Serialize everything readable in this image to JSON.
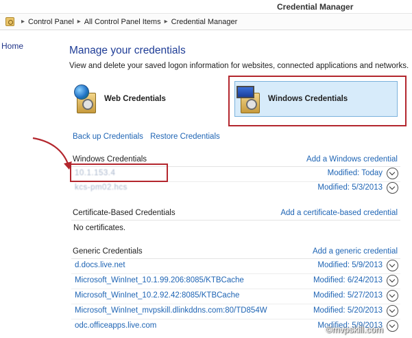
{
  "window": {
    "title": "Credential Manager"
  },
  "breadcrumb": [
    "Control Panel",
    "All Control Panel Items",
    "Credential Manager"
  ],
  "nav": {
    "home": "Home"
  },
  "main": {
    "heading": "Manage your credentials",
    "description": "View and delete your saved logon information for websites, connected applications and networks.",
    "tiles": {
      "web": "Web Credentials",
      "windows": "Windows Credentials"
    },
    "backup_link": "Back up Credentials",
    "restore_link": "Restore Credentials"
  },
  "windows_credentials": {
    "title": "Windows Credentials",
    "add_link": "Add a Windows credential",
    "items": [
      {
        "name": "10.1.153.4",
        "modified": "Modified:  Today"
      },
      {
        "name": "kcs-pm02.hcs",
        "modified": "Modified:  5/3/2013"
      }
    ]
  },
  "cert_credentials": {
    "title": "Certificate-Based Credentials",
    "add_link": "Add a certificate-based credential",
    "empty": "No certificates."
  },
  "generic_credentials": {
    "title": "Generic Credentials",
    "add_link": "Add a generic credential",
    "items": [
      {
        "name": "d.docs.live.net",
        "modified": "Modified:  5/9/2013"
      },
      {
        "name": "Microsoft_WinInet_10.1.99.206:8085/KTBCache",
        "modified": "Modified:  6/24/2013"
      },
      {
        "name": "Microsoft_WinInet_10.2.92.42:8085/KTBCache",
        "modified": "Modified:  5/27/2013"
      },
      {
        "name": "Microsoft_WinInet_mvpskill.dlinkddns.com:80/TD854W",
        "modified": "Modified:  5/20/2013"
      },
      {
        "name": "odc.officeapps.live.com",
        "modified": "Modified:  5/9/2013"
      }
    ]
  },
  "watermark": "©mvpskill.com",
  "colors": {
    "accent_red": "#b3262d",
    "link_blue": "#1e64b4",
    "heading_blue": "#1e3c96",
    "tile_selected": "#d7ebfa"
  },
  "icons": [
    "control-panel-icon",
    "web-credentials-icon",
    "windows-credentials-icon",
    "expand-chevron-icon"
  ]
}
